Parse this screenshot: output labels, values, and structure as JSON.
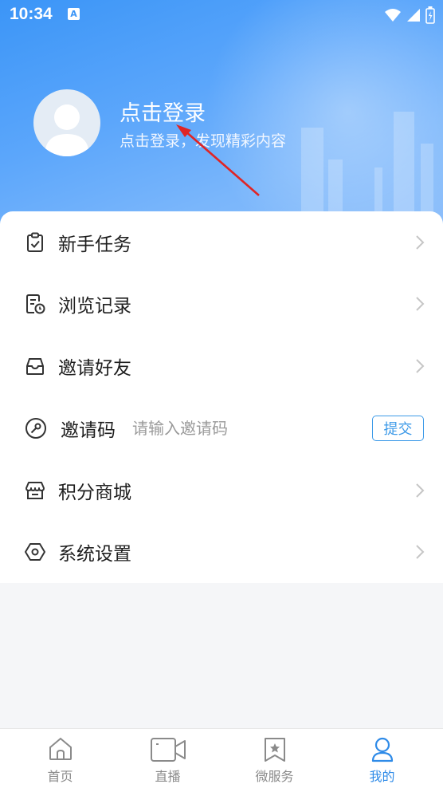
{
  "status_bar": {
    "time": "10:34",
    "notification_badge": "A"
  },
  "profile": {
    "title": "点击登录",
    "subtitle": "点击登录，发现精彩内容",
    "avatar_icon": "user-avatar-icon"
  },
  "menu": {
    "items": [
      {
        "label": "新手任务",
        "icon": "task-clipboard-icon"
      },
      {
        "label": "浏览记录",
        "icon": "history-record-icon"
      },
      {
        "label": "邀请好友",
        "icon": "invite-box-icon"
      },
      {
        "label": "邀请码",
        "icon": "key-icon"
      },
      {
        "label": "积分商城",
        "icon": "store-icon"
      },
      {
        "label": "系统设置",
        "icon": "settings-hexagon-icon"
      }
    ],
    "invite_code": {
      "placeholder": "请输入邀请码",
      "value": "",
      "submit_label": "提交"
    }
  },
  "tabbar": {
    "tabs": [
      {
        "label": "首页",
        "icon": "home-icon",
        "active": false
      },
      {
        "label": "直播",
        "icon": "video-camera-icon",
        "active": false
      },
      {
        "label": "微服务",
        "icon": "bookmark-star-icon",
        "active": false
      },
      {
        "label": "我的",
        "icon": "user-icon",
        "active": true
      }
    ]
  },
  "colors": {
    "accent": "#2f8be8",
    "header_start": "#3b95f7",
    "header_end": "#8fc0fb",
    "inactive_tab": "#8a8a8a"
  }
}
